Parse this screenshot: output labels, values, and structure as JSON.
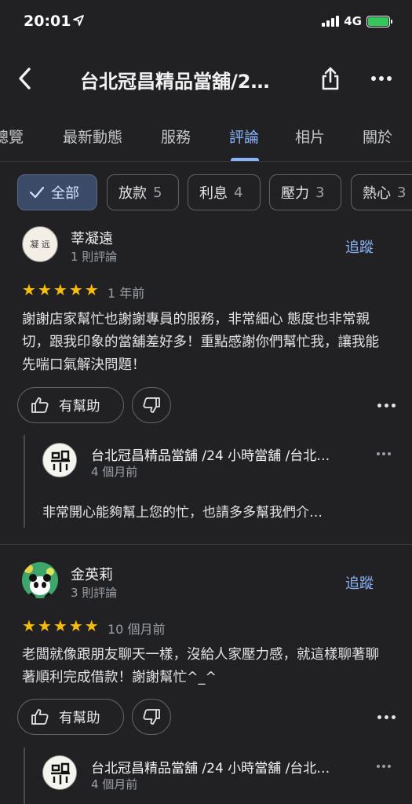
{
  "status_bar": {
    "time": "20:01",
    "network": "4G"
  },
  "header": {
    "title": "台北冠昌精品當舖/2…"
  },
  "tabs": [
    {
      "label": "總覽",
      "active": false
    },
    {
      "label": "最新動態",
      "active": false
    },
    {
      "label": "服務",
      "active": false
    },
    {
      "label": "評論",
      "active": true
    },
    {
      "label": "相片",
      "active": false
    },
    {
      "label": "關於",
      "active": false
    }
  ],
  "chips": [
    {
      "label": "全部",
      "count": "",
      "selected": true
    },
    {
      "label": "放款",
      "count": "5",
      "selected": false
    },
    {
      "label": "利息",
      "count": "4",
      "selected": false
    },
    {
      "label": "壓力",
      "count": "3",
      "selected": false
    },
    {
      "label": "熱心",
      "count": "3",
      "selected": false
    }
  ],
  "reviews": [
    {
      "author": "莘凝遠",
      "author_meta": "1 則評論",
      "avatar_text": "凝 远",
      "follow_label": "追蹤",
      "rating": 5,
      "date": "1 年前",
      "text": "謝謝店家幫忙也謝謝專員的服務，非常細心 態度也非常親切，跟我印象的當舖差好多！重點感謝你們幫忙我，讓我能先喘口氣解決問題！",
      "helpful_label": "有幫助",
      "reply": {
        "name": "台北冠昌精品當舖 /24 小時當舖 /台北…",
        "date": "4 個月前",
        "text": "非常開心能夠幫上您的忙，也請多多幫我們介…"
      }
    },
    {
      "author": "金英莉",
      "author_meta": "3 則評論",
      "follow_label": "追蹤",
      "rating": 5,
      "date": "10 個月前",
      "text": "老闆就像跟朋友聊天一樣，沒給人家壓力感，就這樣聊著聊著順利完成借款！謝謝幫忙^_^",
      "helpful_label": "有幫助",
      "reply": {
        "name": "台北冠昌精品當舖 /24 小時當舖 /台北…",
        "date": "4 個月前"
      }
    }
  ],
  "colors": {
    "accent": "#8ab4f8",
    "star": "#fbbc04",
    "background": "#212124"
  }
}
